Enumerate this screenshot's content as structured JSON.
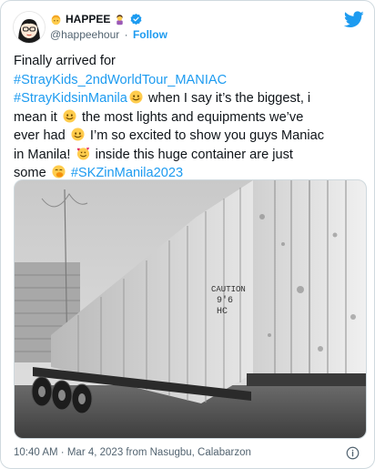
{
  "author": {
    "display_name": "HAPPEE",
    "handle": "@happeehour",
    "follow_label": "Follow",
    "separator": "·",
    "avatar_icon": "cartoon-girl-avatar",
    "verified_icon": "verified-badge-icon"
  },
  "tweet": {
    "lines": [
      [
        {
          "t": "Finally arrived for"
        }
      ],
      [
        {
          "t": "#StrayKids_2ndWorldTour_MANIAC",
          "tag": true
        }
      ],
      [
        {
          "t": "#StrayKidsinManila",
          "tag": true
        },
        {
          "e": "smile"
        },
        {
          "t": " when I say it’s the biggest, i"
        }
      ],
      [
        {
          "t": "mean it "
        },
        {
          "e": "smile"
        },
        {
          "t": " the most lights and equipments we’ve"
        }
      ],
      [
        {
          "t": "ever had "
        },
        {
          "e": "smile"
        },
        {
          "t": " I’m so excited to show you guys Maniac"
        }
      ],
      [
        {
          "t": "in Manila! "
        },
        {
          "e": "hearts"
        },
        {
          "t": " inside this huge container are just"
        }
      ],
      [
        {
          "t": "some "
        },
        {
          "e": "hush"
        },
        {
          "t": " "
        },
        {
          "t": "#SKZinManila2023",
          "tag": true
        }
      ]
    ]
  },
  "photo": {
    "subject": "shipping-container-on-trailer",
    "container_marks": [
      "CAUTION",
      "9'6",
      "HC"
    ]
  },
  "footer": {
    "time": "10:40 AM",
    "separator": "·",
    "date": "Mar 4, 2023",
    "source": "from Nasugbu, Calabarzon"
  },
  "colors": {
    "link": "#1d9bf0",
    "text": "#0f1419",
    "secondary": "#536471",
    "border": "#cfd9de"
  }
}
